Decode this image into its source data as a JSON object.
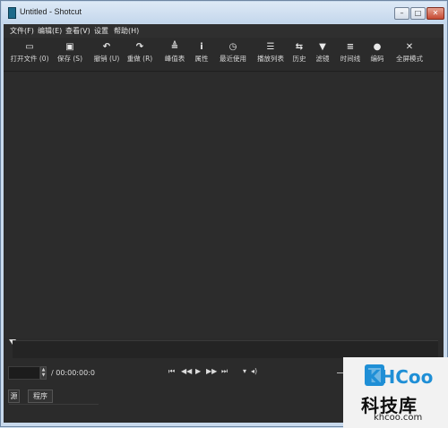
{
  "window": {
    "title": "Untitled - Shotcut"
  },
  "window_controls": {
    "minimize": "–",
    "maximize": "□",
    "close": "✕"
  },
  "menu": [
    {
      "label": "文件(F)"
    },
    {
      "label": "编辑(E)"
    },
    {
      "label": "查看(V)"
    },
    {
      "label": "设置"
    },
    {
      "label": "帮助(H)"
    }
  ],
  "toolbar": [
    {
      "label": "打开文件 (0)",
      "icon": "open-folder-icon",
      "glyph": "▭"
    },
    {
      "label": "保存 (S)",
      "icon": "save-icon",
      "glyph": "▣"
    },
    {
      "label": "撤销 (U)",
      "icon": "undo-icon",
      "glyph": "↶"
    },
    {
      "label": "重做 (R)",
      "icon": "redo-icon",
      "glyph": "↷"
    },
    {
      "label": "峰值表",
      "icon": "peak-meter-icon",
      "glyph": "≜"
    },
    {
      "label": "属性",
      "icon": "info-icon",
      "glyph": "i"
    },
    {
      "label": "最近使用",
      "icon": "clock-icon",
      "glyph": "◷"
    },
    {
      "label": "播放列表",
      "icon": "playlist-icon",
      "glyph": "☰"
    },
    {
      "label": "历史",
      "icon": "history-icon",
      "glyph": "⇆"
    },
    {
      "label": "滤镜",
      "icon": "filter-icon",
      "glyph": "▼"
    },
    {
      "label": "时间线",
      "icon": "timeline-icon",
      "glyph": "≡"
    },
    {
      "label": "编码",
      "icon": "encode-icon",
      "glyph": "●"
    },
    {
      "label": "全屏模式",
      "icon": "fullscreen-icon",
      "glyph": "✕"
    }
  ],
  "transport": {
    "position": "",
    "duration": "/ 00:00:00:0",
    "buttons": [
      {
        "name": "skip-to-start-icon",
        "glyph": "⏮"
      },
      {
        "name": "rewind-icon",
        "glyph": "◀◀"
      },
      {
        "name": "play-icon",
        "glyph": "▶"
      },
      {
        "name": "fast-forward-icon",
        "glyph": "▶▶"
      },
      {
        "name": "skip-to-end-icon",
        "glyph": "⏭"
      },
      {
        "name": "dropdown-icon",
        "glyph": "▾"
      },
      {
        "name": "volume-icon",
        "glyph": "◂)"
      }
    ]
  },
  "tabs": {
    "source": "源",
    "program": "程序"
  },
  "watermark": {
    "logo_text": "KHCoo",
    "cn": "科技库",
    "url": "khcoo.com"
  },
  "colors": {
    "window_bg": "#2b2b2b",
    "titlebar": "#c8d9ec",
    "watermark_blue": "#1f8fd6"
  }
}
